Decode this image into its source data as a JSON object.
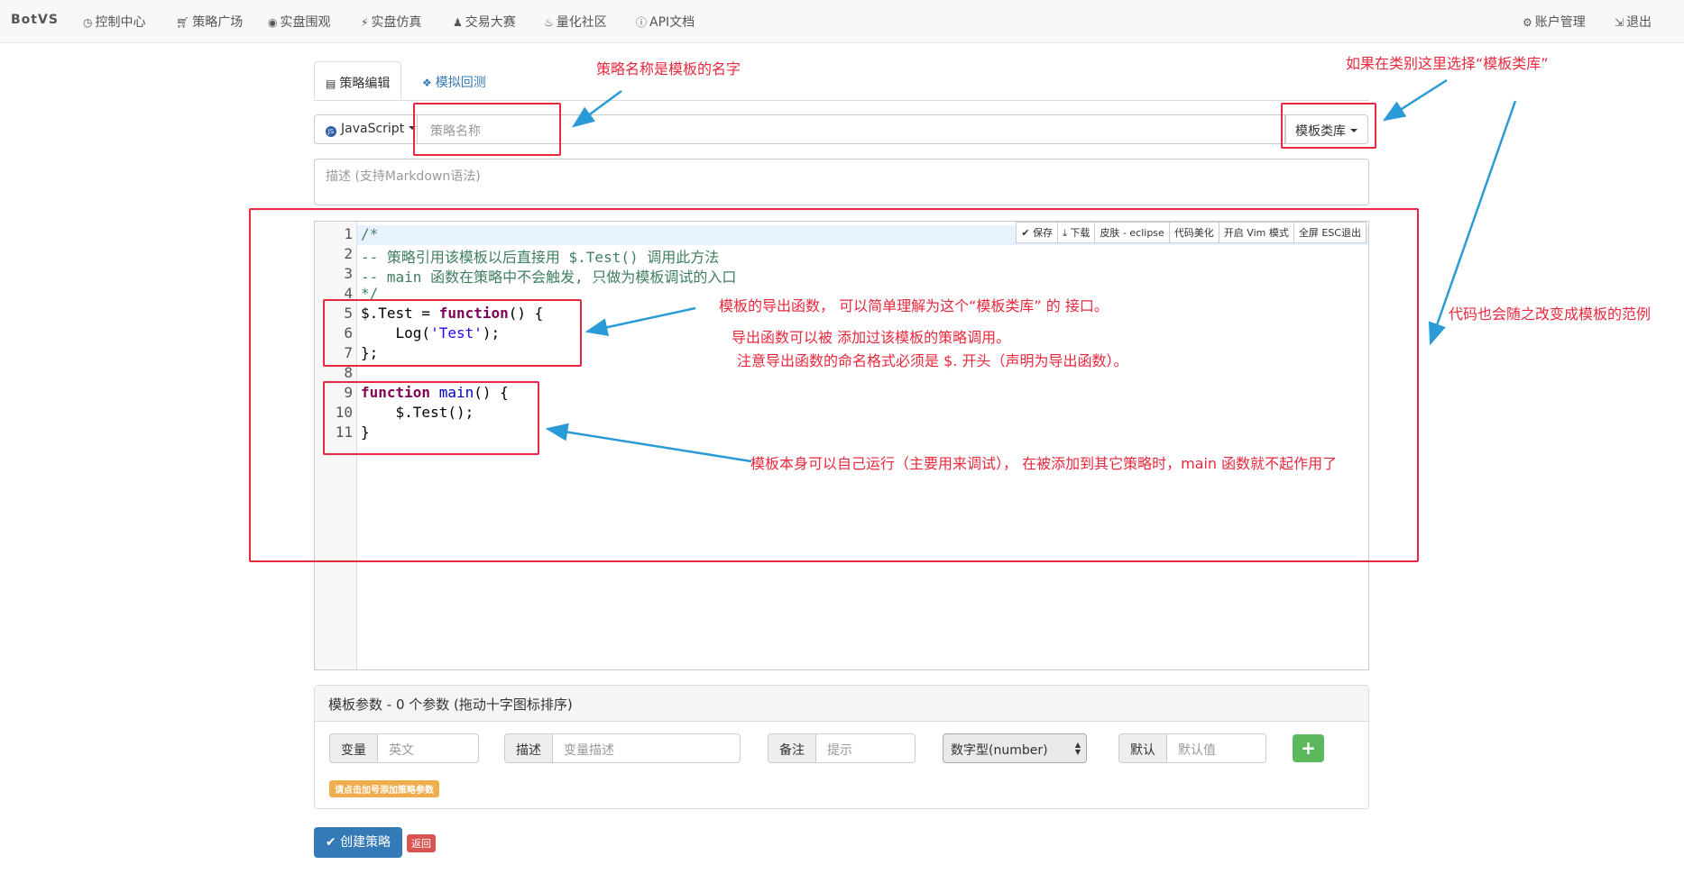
{
  "navbar": {
    "brand": "BotVS",
    "items": [
      {
        "label": "控制中心",
        "icon": "dashboard-icon"
      },
      {
        "label": "策略广场",
        "icon": "cart-icon"
      },
      {
        "label": "实盘围观",
        "icon": "eye-icon"
      },
      {
        "label": "实盘仿真",
        "icon": "flash-icon"
      },
      {
        "label": "交易大赛",
        "icon": "user-icon"
      },
      {
        "label": "量化社区",
        "icon": "fire-icon"
      },
      {
        "label": "API文档",
        "icon": "info-icon"
      }
    ],
    "right": [
      {
        "label": "账户管理",
        "icon": "gear-icon"
      },
      {
        "label": "退出",
        "icon": "logout-icon"
      }
    ]
  },
  "tabs": [
    {
      "label": "策略编辑",
      "icon": "file-icon",
      "active": true
    },
    {
      "label": "模拟回测",
      "icon": "cubes-icon",
      "active": false
    }
  ],
  "form": {
    "language": "JavaScript",
    "name_placeholder": "策略名称",
    "category": "模板类库",
    "description_placeholder": "描述 (支持Markdown语法)"
  },
  "editor": {
    "toolbar": [
      "保存",
      "下载",
      "皮肤 - eclipse",
      "代码美化",
      "开启 Vim 模式",
      "全屏 ESC退出"
    ],
    "line_numbers": [
      "1",
      "2",
      "3",
      "4",
      "5",
      "6",
      "7",
      "8",
      "9",
      "10",
      "11"
    ],
    "lines": {
      "l1": "/*",
      "l2": "-- 策略引用该模板以后直接用 $.Test() 调用此方法",
      "l3": "-- main 函数在策略中不会触发, 只做为模板调试的入口",
      "l4": "*/",
      "l5a": "$.Test = ",
      "l5b": "function",
      "l5c": "() {",
      "l6a": "    Log(",
      "l6b": "'Test'",
      "l6c": ");",
      "l7": "};",
      "l9a": "function",
      "l9b": " ",
      "l9c": "main",
      "l9d": "() {",
      "l10": "    $.Test();",
      "l11": "}"
    }
  },
  "params": {
    "header": "模板参数 - 0 个参数 (拖动十字图标排序)",
    "var_label": "变量",
    "var_placeholder": "英文",
    "desc_label": "描述",
    "desc_placeholder": "变量描述",
    "note_label": "备注",
    "note_placeholder": "提示",
    "type_value": "数字型(number)",
    "default_label": "默认",
    "default_placeholder": "默认值",
    "add_button": "+",
    "hint": "请点击加号添加策略参数"
  },
  "actions": {
    "create": "创建策略",
    "back": "返回"
  },
  "annotations": {
    "name_note": "策略名称是模板的名字",
    "category_note": "如果在类别这里选择“模板类库”",
    "code_note": "代码也会随之改变成模板的范例",
    "export_note_1": "模板的导出函数， 可以简单理解为这个“模板类库” 的 接口。",
    "export_note_2": "导出函数可以被 添加过该模板的策略调用。",
    "export_note_3": "注意导出函数的命名格式必须是 $.  开头（声明为导出函数）。",
    "main_note": "模板本身可以自己运行（主要用来调试）， 在被添加到其它策略时，main 函数就不起作用了"
  }
}
